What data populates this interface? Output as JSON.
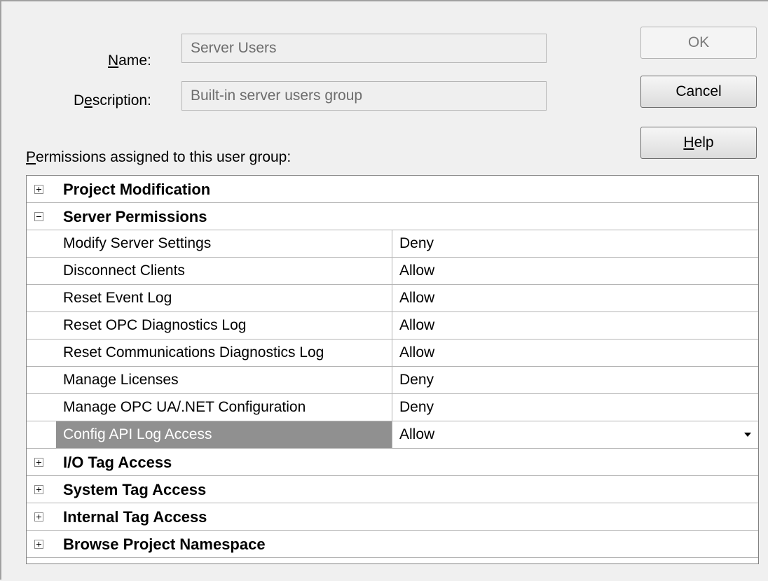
{
  "form": {
    "name_label_pre": "",
    "name_label_mn": "N",
    "name_label_post": "ame:",
    "name_value": "Server Users",
    "description_label_pre": "D",
    "description_label_mn": "e",
    "description_label_post": "scription:",
    "description_value": "Built-in server users group",
    "permissions_label_mn": "P",
    "permissions_label_post": "ermissions assigned to this user group:"
  },
  "buttons": {
    "ok": "OK",
    "cancel": "Cancel",
    "help_mn": "H",
    "help_post": "elp"
  },
  "grid": {
    "categories_top": [
      {
        "label": "Project Modification",
        "expander": "plus-icon"
      },
      {
        "label": "Server Permissions",
        "expander": "minus-icon"
      }
    ],
    "properties": [
      {
        "name": "Modify Server Settings",
        "value": "Deny"
      },
      {
        "name": "Disconnect Clients",
        "value": "Allow"
      },
      {
        "name": "Reset Event Log",
        "value": "Allow"
      },
      {
        "name": "Reset OPC Diagnostics Log",
        "value": "Allow"
      },
      {
        "name": "Reset Communications Diagnostics Log",
        "value": "Allow"
      },
      {
        "name": "Manage Licenses",
        "value": "Deny"
      },
      {
        "name": "Manage OPC UA/.NET Configuration",
        "value": "Deny"
      },
      {
        "name": "Config API Log Access",
        "value": "Allow",
        "selected": true
      }
    ],
    "categories_bottom": [
      {
        "label": "I/O Tag Access",
        "expander": "plus-icon"
      },
      {
        "label": "System Tag Access",
        "expander": "plus-icon"
      },
      {
        "label": "Internal Tag Access",
        "expander": "plus-icon"
      },
      {
        "label": "Browse Project Namespace",
        "expander": "plus-icon"
      }
    ]
  },
  "colors": {
    "dialog_bg": "#f0f0f0",
    "selected_row_bg": "#909090",
    "grid_line": "#b4b4b4"
  }
}
